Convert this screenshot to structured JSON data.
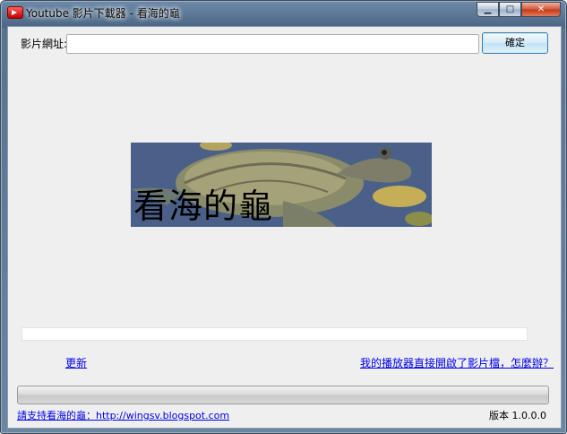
{
  "window": {
    "title": "Youtube 影片下載器 - 看海的龜",
    "min_glyph": "▁",
    "max_glyph": "□",
    "close_glyph": "✕",
    "app_icon": "youtube-icon"
  },
  "form": {
    "url_label": "影片網址:",
    "url_value": "",
    "ok_label": "確定"
  },
  "banner": {
    "text": "看海的龜",
    "image": "sea-turtle-image"
  },
  "progress": {
    "top_value": 0,
    "bottom_value": 0
  },
  "links": {
    "update": "更新",
    "help": "我的播放器直接開啟了影片檔，怎麼辦？"
  },
  "footer": {
    "support_text": "請支持看海的龜：",
    "support_url": "http://wingsv.blogspot.com",
    "version": "版本 1.0.0.0"
  }
}
